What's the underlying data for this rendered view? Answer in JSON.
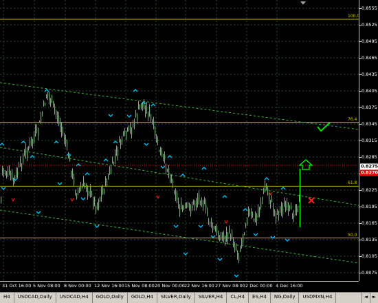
{
  "chart": {
    "price_ticks": [
      "0.8555",
      "0.8525",
      "0.8495",
      "0.8465",
      "0.8435",
      "0.8405",
      "0.8375",
      "0.8345",
      "0.8315",
      "0.8285",
      "0.8255",
      "0.8225",
      "0.8195",
      "0.8165",
      "0.8135",
      "0.8105",
      "0.8075"
    ],
    "current_price": "0.8275",
    "red_price": "0.8270",
    "fib_levels": [
      {
        "label": "100.0",
        "value": 0.8535
      },
      {
        "label": "76.4",
        "value": 0.8348
      },
      {
        "label": "61.8",
        "value": 0.8232
      },
      {
        "label": "50.0",
        "value": 0.8138
      }
    ],
    "time_labels": [
      "31 Oct 16:00",
      "5 Nov 08:00",
      "8 Nov 00:00",
      "12 Nov 16:00",
      "15 Nov 08:00",
      "20 Nov 00:00",
      "22 Nov 16:00",
      "27 Nov 08:00",
      "2 Dec 00:00",
      "4 Dec 16:00"
    ],
    "colors": {
      "background": "#000000",
      "grid": "#2e4e2e",
      "candle": "#00ff00",
      "fib": "#c8b400",
      "channel": "#3cb43c",
      "buy_arrow": "#00ff00",
      "sell_mark": "#ff2020",
      "check_mark": "#00e000",
      "fractal_up": "#00c8ff",
      "red_line": "#ff0000"
    },
    "signals": {
      "buy_arrow_icon": "up-arrow-outline",
      "check_icon": "check-mark",
      "cross_icon": "x-mark"
    }
  },
  "tabs": [
    {
      "label": "H4",
      "active": false
    },
    {
      "label": "USDCAD,Daily",
      "active": false
    },
    {
      "label": "USDCAD,H4",
      "active": false
    },
    {
      "label": "GOLD,Daily",
      "active": false
    },
    {
      "label": "GOLD,H4",
      "active": false
    },
    {
      "label": "SILVER,Daily",
      "active": false
    },
    {
      "label": "SILVER,H4",
      "active": false
    },
    {
      "label": "CL,H4",
      "active": false
    },
    {
      "label": "ES,H4",
      "active": false
    },
    {
      "label": "NG,Daily",
      "active": false
    },
    {
      "label": "USDMXN,H4",
      "active": false
    }
  ],
  "tab_scroll": {
    "left": "◄",
    "right": "►"
  }
}
